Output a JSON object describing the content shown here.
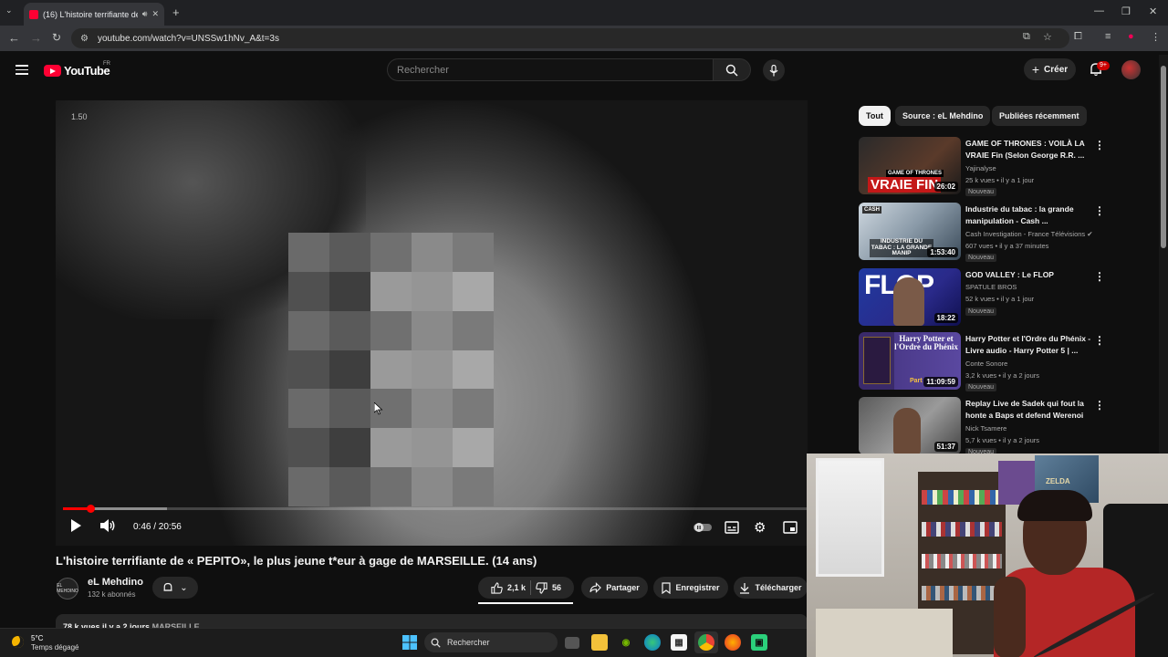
{
  "browser": {
    "tab_title": "(16) L'histoire terrifiante de",
    "url": "youtube.com/watch?v=UNSSw1hNv_A&t=3s",
    "icons": [
      "tab-list-icon",
      "sound-icon",
      "close-icon",
      "new-tab-icon",
      "back-icon",
      "forward-icon",
      "reload-icon",
      "site-info-icon",
      "install-icon",
      "star-icon",
      "extensions-icon",
      "media-icon",
      "profile-icon",
      "menu-icon",
      "minimize-icon",
      "maximize-icon"
    ]
  },
  "youtube": {
    "logo_text": "YouTube",
    "logo_country": "FR",
    "search_placeholder": "Rechercher",
    "create_label": "Créer",
    "notif_count": "9+"
  },
  "player": {
    "speed_label": "1.50",
    "time": "0:46 / 20:56",
    "played_fraction": 0.037,
    "buffered_fraction": 0.14
  },
  "video": {
    "title": "L'histoire terrifiante de « PEPITO», le plus jeune t*eur à gage de MARSEILLE. (14 ans)",
    "channel": "eL Mehdino",
    "channel_avatar_text": "EL MEHDINO",
    "subscribers": "132 k abonnés",
    "likes": "2,1 k",
    "dislikes": "56",
    "share": "Partager",
    "save": "Enregistrer",
    "download": "Télécharger",
    "desc_line": "78 k vues  il y a 2 jours",
    "desc_tag": "MARSEILLE"
  },
  "chips": [
    "Tout",
    "Source : eL Mehdino",
    "Publiées récemment"
  ],
  "suggestions": [
    {
      "title": "GAME OF THRONES : VOILÀ LA VRAIE Fin (Selon George R.R. ...",
      "channel": "Yajinalyse",
      "stats": "25 k vues • il y a 1 jour",
      "badge": "Nouveau",
      "duration": "26:02",
      "thumb_text": "VRAIE FIN",
      "thumb_small": "GAME OF THRONES"
    },
    {
      "title": "Industrie du tabac : la grande manipulation - Cash ...",
      "channel": "Cash Investigation - France Télévisions",
      "stats": "607 vues • il y a 37 minutes",
      "badge": "Nouveau",
      "duration": "1:53:40",
      "thumb_text": "INDUSTRIE DU TABAC : LA GRANDE MANIP",
      "thumb_small": "CASH"
    },
    {
      "title": "GOD VALLEY : Le FLOP",
      "channel": "SPATULE BROS",
      "stats": "52 k vues • il y a 1 jour",
      "badge": "Nouveau",
      "duration": "18:22",
      "thumb_text": "FLOP",
      "thumb_small": ""
    },
    {
      "title": "Harry Potter et l'Ordre du Phénix - Livre audio - Harry Potter 5 | ...",
      "channel": "Conte Sonore",
      "stats": "3,2 k vues • il y a 2 jours",
      "badge": "Nouveau",
      "duration": "11:09:59",
      "thumb_text": "Harry Potter et l'Ordre du Phénix",
      "thumb_small": "Part"
    },
    {
      "title": "Replay Live de Sadek qui fout la honte a Baps et defend Werenoi",
      "channel": "Nick Tsamere",
      "stats": "5,7 k vues • il y a 2 jours",
      "badge": "Nouveau",
      "duration": "51:37",
      "thumb_text": "",
      "thumb_small": ""
    }
  ],
  "webcam": {
    "poster_text": "ZELDA"
  },
  "taskbar": {
    "temp": "5°C",
    "weather": "Temps dégagé",
    "search": "Rechercher",
    "app_icons": [
      "windows-start-icon",
      "task-view-icon",
      "file-explorer-icon",
      "nvidia-icon",
      "edge-icon",
      "store-icon",
      "chrome-icon",
      "firefox-icon",
      "app-icon"
    ]
  },
  "colors": {
    "yt_red": "#ff0033",
    "bg": "#0f0f0f",
    "chip": "#272727"
  }
}
